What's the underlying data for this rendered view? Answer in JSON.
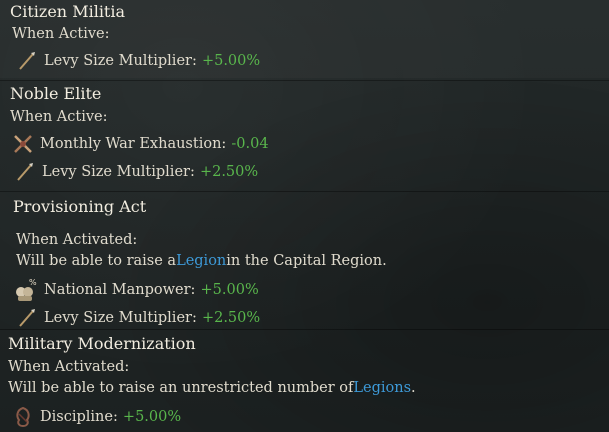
{
  "sections": [
    {
      "title": "Citizen Militia",
      "condition": "When Active:",
      "effects": [
        {
          "icon": "levy-spear-icon",
          "label": "Levy Size Multiplier:",
          "value": "+5.00%"
        }
      ]
    },
    {
      "title": "Noble Elite",
      "condition": "When Active:",
      "effects": [
        {
          "icon": "war-exhaustion-icon",
          "label": "Monthly War Exhaustion:",
          "value": "-0.04"
        },
        {
          "icon": "levy-spear-icon",
          "label": "Levy Size Multiplier:",
          "value": "+2.50%"
        }
      ]
    },
    {
      "title": "Provisioning Act",
      "condition": "When Activated:",
      "desc_pre": "Will be able to raise a ",
      "desc_link": "Legion",
      "desc_post": " in the Capital Region.",
      "effects": [
        {
          "icon": "manpower-icon",
          "label": "National Manpower:",
          "value": "+5.00%"
        },
        {
          "icon": "levy-spear-icon",
          "label": "Levy Size Multiplier:",
          "value": "+2.50%"
        }
      ]
    },
    {
      "title": "Military Modernization",
      "condition": "When Activated:",
      "desc_pre": "Will be able to raise an unrestricted number of ",
      "desc_link": "Legions",
      "desc_post": ".",
      "effects": [
        {
          "icon": "discipline-icon",
          "label": "Discipline:",
          "value": "+5.00%"
        }
      ]
    }
  ],
  "colors": {
    "positive": "#59b64c",
    "link": "#3d9ad8",
    "text": "#e0dbcd"
  }
}
